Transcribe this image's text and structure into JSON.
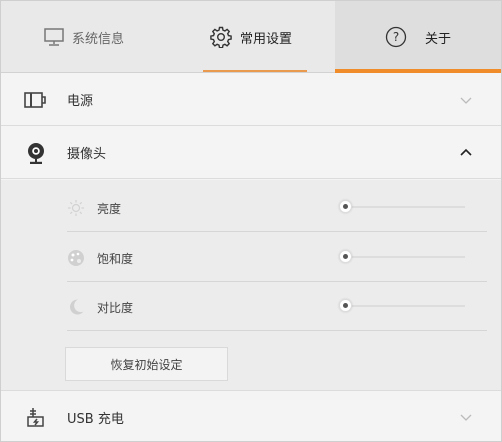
{
  "tabs": [
    {
      "label": "系统信息",
      "icon": "monitor-icon"
    },
    {
      "label": "常用设置",
      "icon": "gear-icon"
    },
    {
      "label": "关于",
      "icon": "help-circle-icon"
    }
  ],
  "sections": {
    "power": {
      "label": "电源",
      "icon": "battery-icon",
      "expanded": false
    },
    "camera": {
      "label": "摄像头",
      "icon": "webcam-icon",
      "expanded": true,
      "settings": [
        {
          "label": "亮度",
          "icon": "sun-icon",
          "level": 0
        },
        {
          "label": "饱和度",
          "icon": "palette-icon",
          "level": 0
        },
        {
          "label": "对比度",
          "icon": "moon-icon",
          "level": 0
        }
      ],
      "reset_label": "恢复初始设定"
    },
    "usb": {
      "label": "USB 充电",
      "icon": "usb-charge-icon",
      "expanded": false
    }
  },
  "colors": {
    "accent": "#f08c2a"
  }
}
